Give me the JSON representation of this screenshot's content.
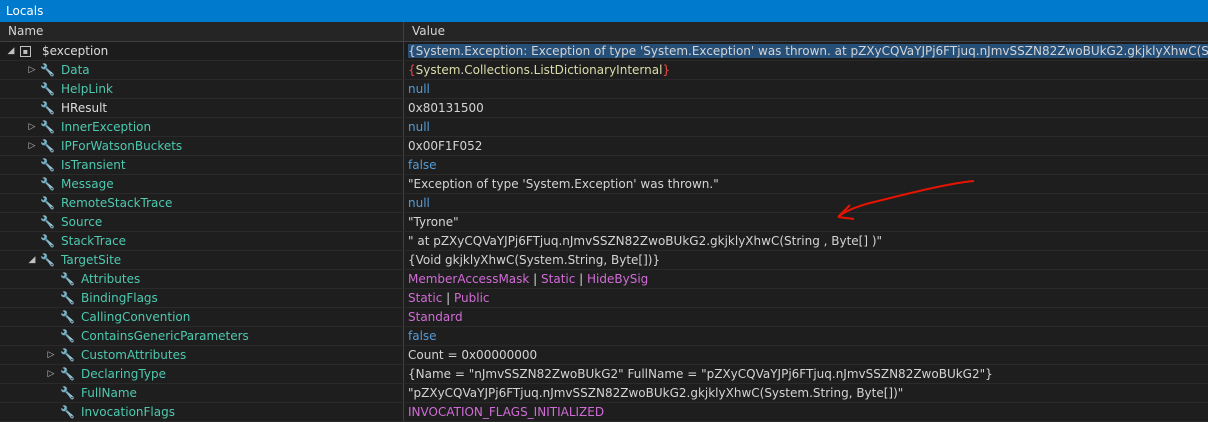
{
  "window": {
    "title": "Locals"
  },
  "columns": {
    "name": "Name",
    "value": "Value"
  },
  "rows": [
    {
      "name": "$exception",
      "value": "{System.Exception: Exception of type 'System.Exception' was thrown.     at pZXyCQVaYJPj6FTjuq.nJmvSSZN82ZwoBUkG2.gkjklyXhwC(String  , Byte[]  )}"
    },
    {
      "name": "Data",
      "v1": "{",
      "v2": "System",
      "v3": ".",
      "v4": "Collections",
      "v5": ".",
      "v6": "ListDictionaryInternal",
      "v7": "}"
    },
    {
      "name": "HelpLink",
      "value": "null"
    },
    {
      "name": "HResult",
      "value": "0x80131500"
    },
    {
      "name": "InnerException",
      "value": "null"
    },
    {
      "name": "IPForWatsonBuckets",
      "value": "0x00F1F052"
    },
    {
      "name": "IsTransient",
      "value": "false"
    },
    {
      "name": "Message",
      "value": "\"Exception of type 'System.Exception' was thrown.\""
    },
    {
      "name": "RemoteStackTrace",
      "value": "null"
    },
    {
      "name": "Source",
      "value": "\"Tyrone\""
    },
    {
      "name": "StackTrace",
      "value": "\"    at pZXyCQVaYJPj6FTjuq.nJmvSSZN82ZwoBUkG2.gkjklyXhwC(String  , Byte[]  )\""
    },
    {
      "name": "TargetSite",
      "value": "{Void gkjklyXhwC(System.String, Byte[])}"
    },
    {
      "name": "Attributes",
      "v1": "MemberAccessMask",
      "v2": " | ",
      "v3": "Static",
      "v4": " | ",
      "v5": "HideBySig"
    },
    {
      "name": "BindingFlags",
      "v1": "Static",
      "v2": " | ",
      "v3": "Public"
    },
    {
      "name": "CallingConvention",
      "value": "Standard"
    },
    {
      "name": "ContainsGenericParameters",
      "value": "false"
    },
    {
      "name": "CustomAttributes",
      "value": "Count = 0x00000000"
    },
    {
      "name": "DeclaringType",
      "value": "{Name = \"nJmvSSZN82ZwoBUkG2\" FullName = \"pZXyCQVaYJPj6FTjuq.nJmvSSZN82ZwoBUkG2\"}"
    },
    {
      "name": "FullName",
      "value": "\"pZXyCQVaYJPj6FTjuq.nJmvSSZN82ZwoBUkG2.gkjklyXhwC(System.String, Byte[])\""
    },
    {
      "name": "InvocationFlags",
      "value": "INVOCATION_FLAGS_INITIALIZED"
    }
  ],
  "colors": {
    "accent": "#007acc",
    "annotation": "#e51400"
  }
}
